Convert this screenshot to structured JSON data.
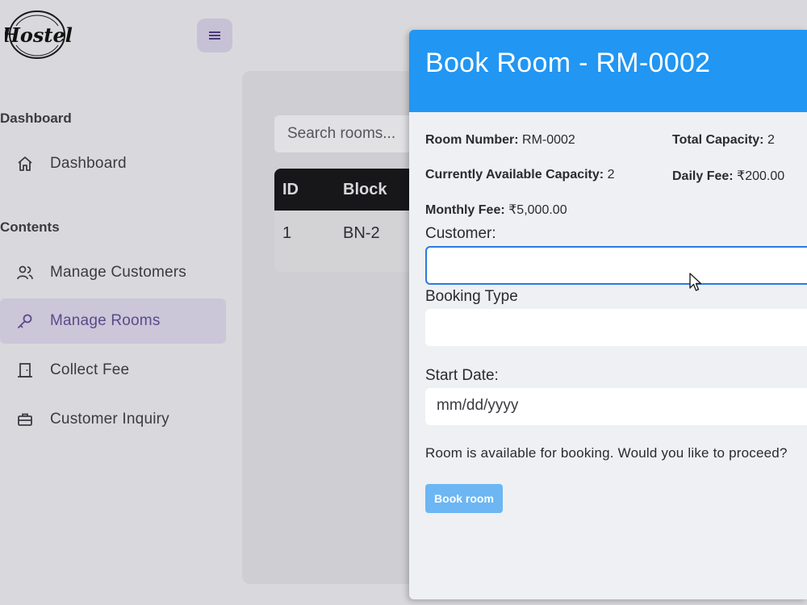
{
  "brand": {
    "logo_text": "Hostel"
  },
  "sidebar": {
    "sections": [
      "Dashboard",
      "Contents"
    ],
    "items": [
      {
        "label": "Dashboard",
        "icon": "home-icon"
      },
      {
        "label": "Manage Customers",
        "icon": "users-icon"
      },
      {
        "label": "Manage Rooms",
        "icon": "key-icon",
        "active": true
      },
      {
        "label": "Collect Fee",
        "icon": "door-icon"
      },
      {
        "label": "Customer Inquiry",
        "icon": "briefcase-icon"
      }
    ]
  },
  "main": {
    "search_placeholder": "Search rooms...",
    "table": {
      "columns": [
        "ID",
        "Block"
      ],
      "rows": [
        [
          "1",
          "BN-2"
        ]
      ]
    }
  },
  "modal": {
    "title": "Book Room - RM-0002",
    "info": {
      "room_number_label": "Room Number:",
      "room_number": "RM-0002",
      "total_capacity_label": "Total Capacity:",
      "total_capacity": "2",
      "available_capacity_label": "Currently Available Capacity:",
      "available_capacity": "2",
      "daily_fee_label": "Daily Fee:",
      "daily_fee": "₹200.00",
      "monthly_fee_label": "Monthly Fee:",
      "monthly_fee": "₹5,000.00"
    },
    "customer_label": "Customer:",
    "customer_value": "",
    "booking_type_label": "Booking Type",
    "booking_type_value": "",
    "start_date_label": "Start Date:",
    "start_date_placeholder": "mm/dd/yyyy",
    "availability_text": "Room is available for booking. Would you like to proceed?",
    "book_button": "Book room"
  },
  "colors": {
    "header_blue": "#2196f3",
    "button_blue": "#6cb6f3",
    "active_nav": "#cbc6d8"
  }
}
